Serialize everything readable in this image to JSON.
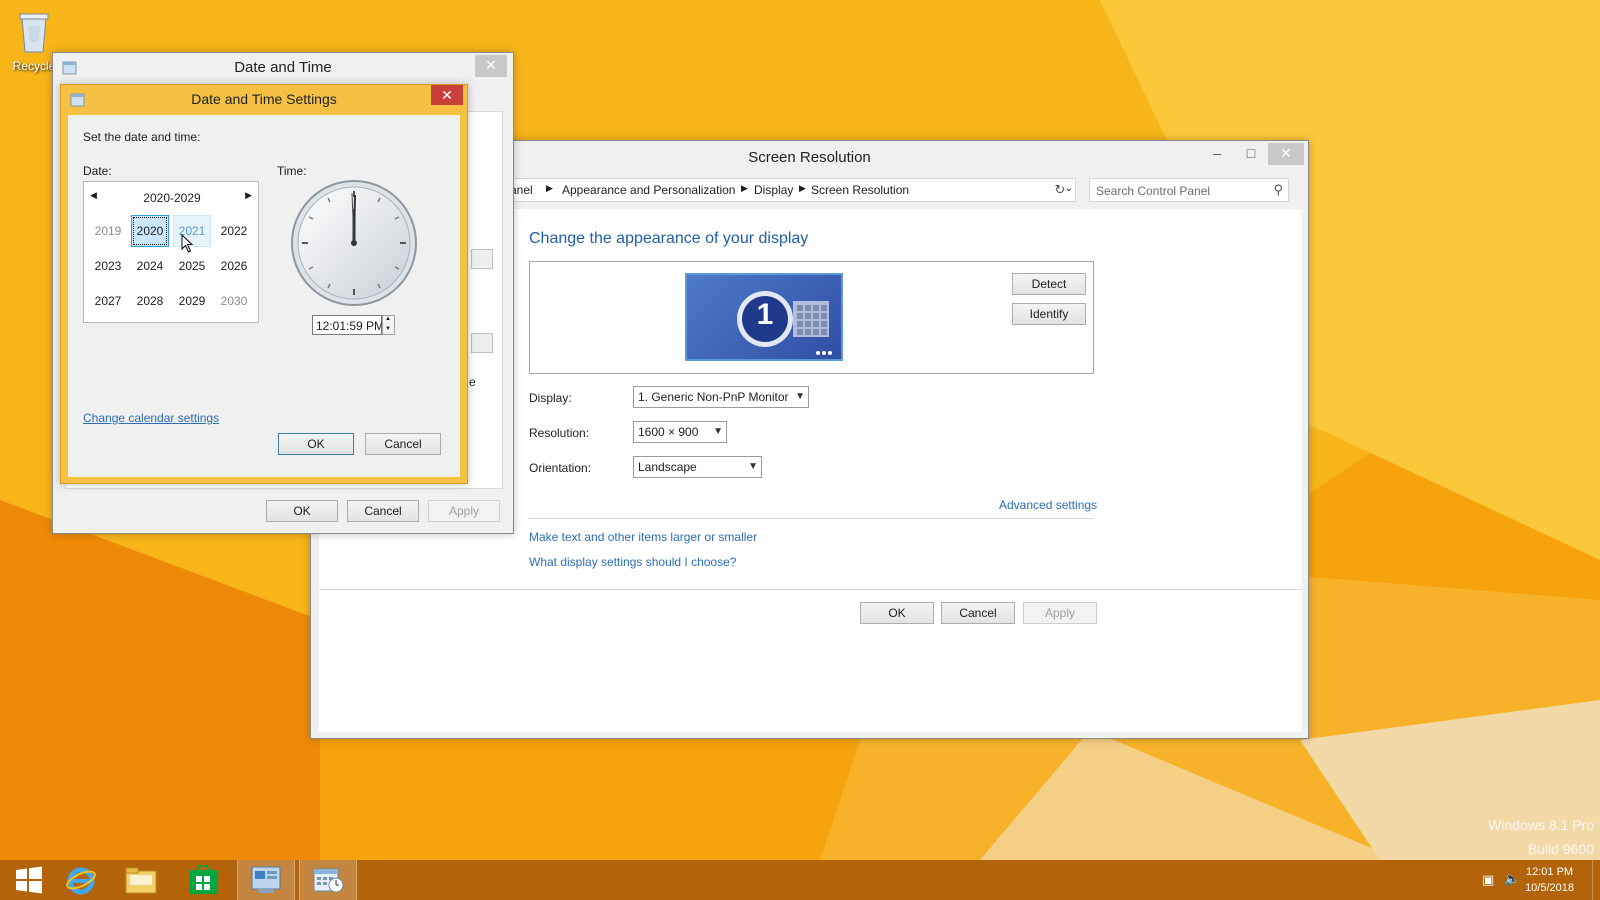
{
  "desktop": {
    "recycle_bin_label": "Recycle"
  },
  "watermark": {
    "line1": "Windows 8.1 Pro",
    "line2": "Build 9600"
  },
  "taskbar": {
    "clock_time": "12:01 PM",
    "clock_date": "10/5/2018"
  },
  "screen_resolution": {
    "title": "Screen Resolution",
    "breadcrumb": [
      "anel",
      "Appearance and Personalization",
      "Display",
      "Screen Resolution"
    ],
    "search_placeholder": "Search Control Panel",
    "heading": "Change the appearance of your display",
    "monitor_number": "1",
    "detect_label": "Detect",
    "identify_label": "Identify",
    "display_label": "Display:",
    "display_value": "1. Generic Non-PnP Monitor",
    "resolution_label": "Resolution:",
    "resolution_value": "1600 × 900",
    "orientation_label": "Orientation:",
    "orientation_value": "Landscape",
    "advanced_link": "Advanced settings",
    "link_text_size": "Make text and other items larger or smaller",
    "link_which_settings": "What display settings should I choose?",
    "ok_label": "OK",
    "cancel_label": "Cancel",
    "apply_label": "Apply"
  },
  "date_time": {
    "title": "Date and Time",
    "partial_text": "e",
    "ok_label": "OK",
    "cancel_label": "Cancel",
    "apply_label": "Apply"
  },
  "date_time_settings": {
    "title": "Date and Time Settings",
    "instruction": "Set the date and time:",
    "date_label": "Date:",
    "time_label": "Time:",
    "decade_range": "2020-2029",
    "years": [
      [
        "2019",
        "2020",
        "2021",
        "2022"
      ],
      [
        "2023",
        "2024",
        "2025",
        "2026"
      ],
      [
        "2027",
        "2028",
        "2029",
        "2030"
      ]
    ],
    "selected_year": "2020",
    "time_value": "12:01:59 PM",
    "change_calendar_link": "Change calendar settings",
    "ok_label": "OK",
    "cancel_label": "Cancel"
  },
  "colors": {
    "link": "#2a6fb5",
    "heading": "#1f5fa6",
    "accent_titlebar": "#f6c042",
    "close_red": "#c7403a",
    "selection": "#cce8ff"
  }
}
